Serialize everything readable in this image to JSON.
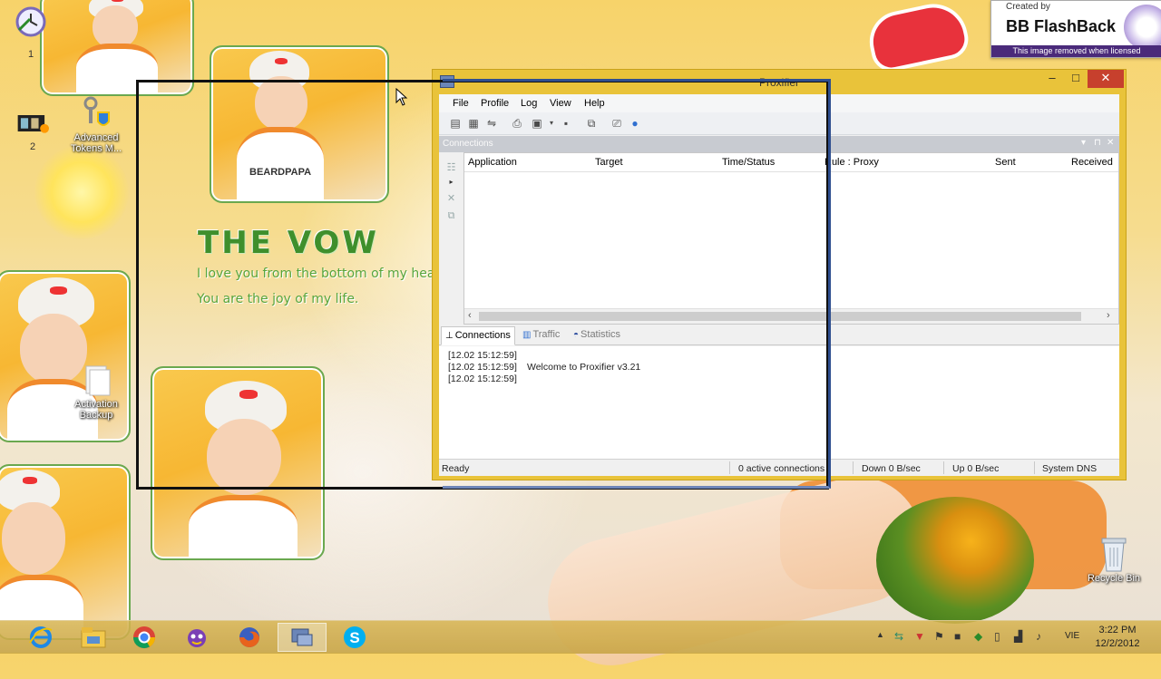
{
  "watermark": {
    "created_by": "Created by",
    "brand": "BB FlashBack",
    "notice": "This image removed when licensed"
  },
  "wallpaper": {
    "title": "THE VOW",
    "line1": "I love you from the bottom of my heart.",
    "line2": "You are the joy of my life.",
    "shirt_text": "BEARDPAPA"
  },
  "desktop_icons": [
    {
      "label": "1",
      "icon": "clock-icon"
    },
    {
      "label": "2",
      "icon": "video-icon"
    },
    {
      "label": "Advanced Tokens M...",
      "icon": "keys-shield-icon"
    },
    {
      "label": "Activation Backup",
      "icon": "folder-icon"
    },
    {
      "label": "Recycle Bin",
      "icon": "recycle-bin-icon"
    }
  ],
  "window": {
    "title": "Proxifier",
    "controls": {
      "minimize": "–",
      "maximize": "□",
      "close": "✕"
    },
    "menu": [
      "File",
      "Profile",
      "Log",
      "View",
      "Help"
    ],
    "pane_title": "Connections",
    "columns": [
      "Application",
      "Target",
      "Time/Status",
      "Rule : Proxy",
      "Sent",
      "Received"
    ],
    "tabs": [
      {
        "label": "Connections",
        "active": true
      },
      {
        "label": "Traffic",
        "active": false
      },
      {
        "label": "Statistics",
        "active": false
      }
    ],
    "log": [
      {
        "time": "[12.02 15:12:59]",
        "message": ""
      },
      {
        "time": "[12.02 15:12:59]",
        "message": "Welcome to Proxifier v3.21"
      },
      {
        "time": "[12.02 15:12:59]",
        "message": ""
      }
    ],
    "status": {
      "state": "Ready",
      "connections": "0 active connections",
      "down": "Down 0 B/sec",
      "up": "Up 0 B/sec",
      "dns": "System DNS"
    }
  },
  "taskbar": {
    "apps": [
      "internet-explorer-icon",
      "file-explorer-icon",
      "chrome-icon",
      "messenger-icon",
      "firefox-icon",
      "proxifier-icon",
      "skype-icon"
    ],
    "language": "VIE",
    "time": "3:22 PM",
    "date": "12/2/2012"
  }
}
